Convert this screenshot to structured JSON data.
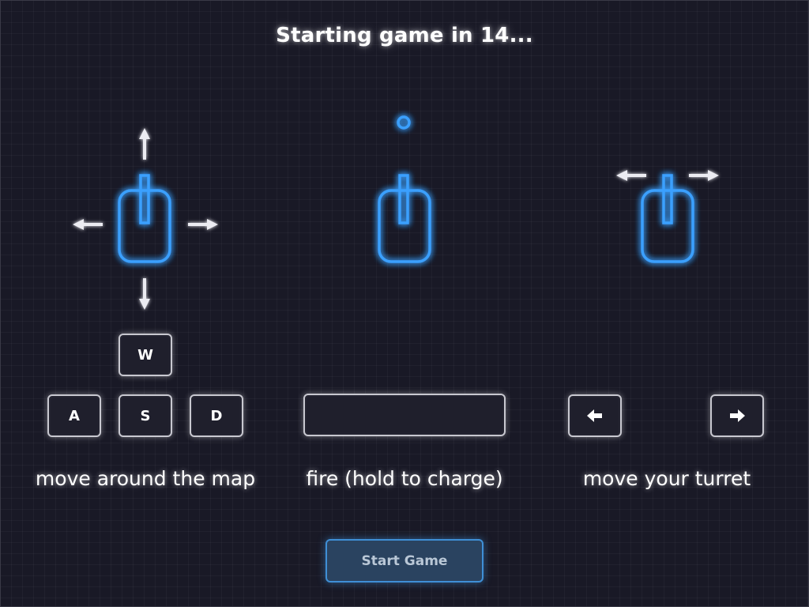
{
  "countdown": {
    "title": "Starting game in 14..."
  },
  "controls": [
    {
      "id": "move",
      "label": "move around the map",
      "keys": [
        "W",
        "A",
        "S",
        "D"
      ]
    },
    {
      "id": "fire",
      "label": "fire (hold to charge)",
      "keys": [
        "space"
      ]
    },
    {
      "id": "turret",
      "label": "move your turret",
      "keys": [
        "arrow-left",
        "arrow-right"
      ]
    }
  ],
  "button": {
    "label": "Start Game"
  },
  "colors": {
    "background": "#191926",
    "neon_blue": "#3aa0ff",
    "key_border": "#c8c8d0",
    "button_fill": "#2a4360"
  }
}
